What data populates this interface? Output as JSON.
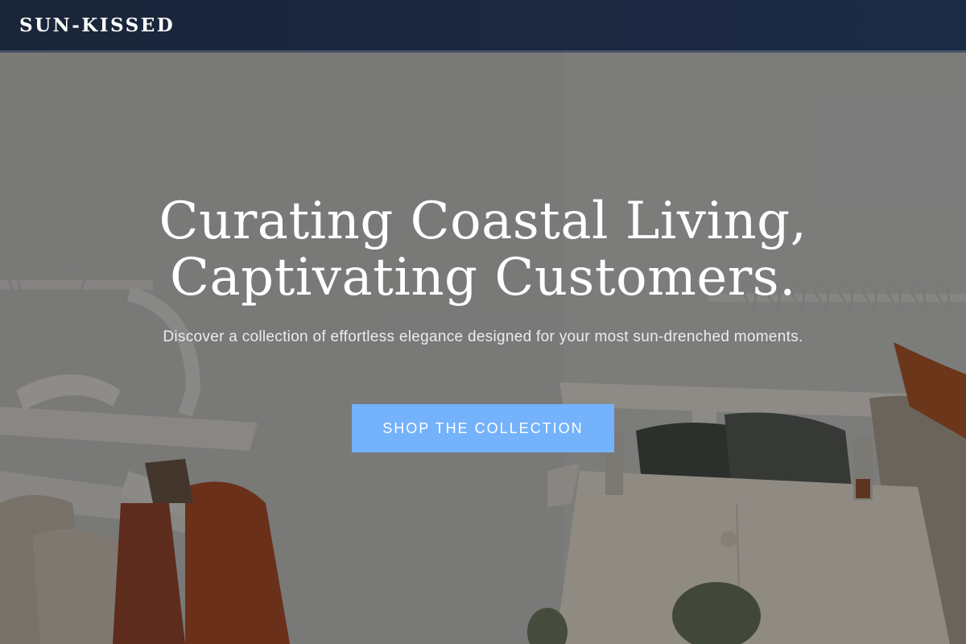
{
  "header": {
    "brand": "SUN-KISSED"
  },
  "hero": {
    "headline_line1": "Curating Coastal Living,",
    "headline_line2": "Captivating Customers.",
    "subheading": "Discover a collection of effortless elegance designed for your most sun-drenched moments.",
    "cta_label": "SHOP THE COLLECTION",
    "background_image": "clothing-rack-photo"
  },
  "colors": {
    "header_bg": "#1b2740",
    "cta_bg": "#74b2fb",
    "text": "#ffffff"
  }
}
